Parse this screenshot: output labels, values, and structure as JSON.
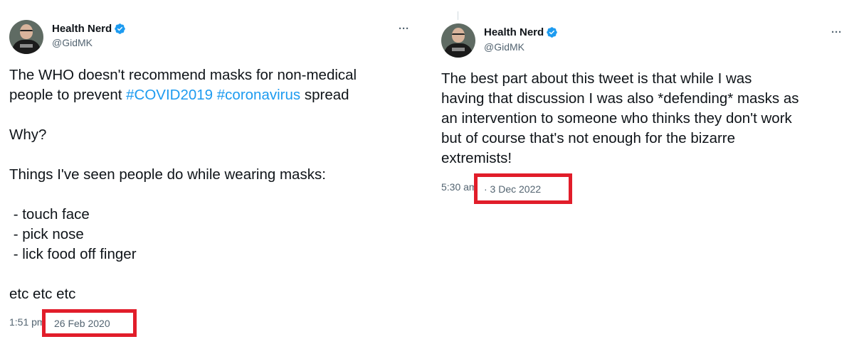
{
  "left_tweet": {
    "author_name": "Health Nerd",
    "author_handle": "@GidMK",
    "more_label": "···",
    "text_line1": "The WHO doesn't recommend masks for non-medical",
    "text_line2_prefix": "people to prevent ",
    "hashtag1": "#COVID2019",
    "hashtag2": "#coronavirus",
    "text_line2_suffix": " spread",
    "why": "Why?",
    "things": "Things I've seen people do while wearing masks:",
    "list": [
      " - touch face",
      " - pick nose",
      " - lick food off finger"
    ],
    "etc": "etc etc etc",
    "time": "1:51 pm",
    "date": "26 Feb 2020"
  },
  "right_tweet": {
    "author_name": "Health Nerd",
    "author_handle": "@GidMK",
    "more_label": "···",
    "lines": [
      "The best part about this tweet is that while I was",
      "having that discussion I was also *defending* masks as",
      "an intervention to someone who thinks they don't work",
      "but of course that's not enough for the bizarre",
      "extremists!"
    ],
    "time": "5:30 am",
    "date": "· 3 Dec 2022"
  },
  "colors": {
    "accent": "#1d9bf0",
    "highlight_box": "#e11d2a",
    "secondary_text": "#536471"
  }
}
